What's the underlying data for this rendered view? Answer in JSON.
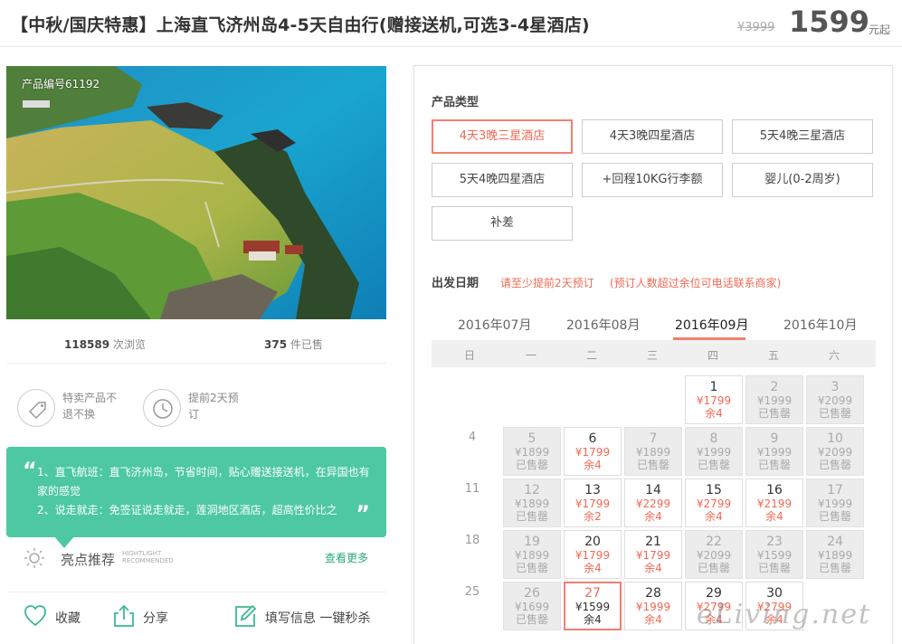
{
  "header": {
    "title": "【中秋/国庆特惠】上海直飞济州岛4-5天自由行(赠接送机,可选3-4星酒店)",
    "original_price": "¥3999",
    "price": "1599",
    "price_unit": "元起"
  },
  "gallery": {
    "product_code": "产品编号61192"
  },
  "stats": {
    "views_value": "118589",
    "views_label": "次浏览",
    "sold_value": "375",
    "sold_label": "件已售"
  },
  "promises": [
    {
      "icon": "tag-icon",
      "text": "特卖产品不退不换"
    },
    {
      "icon": "clock-icon",
      "text": "提前2天预订"
    }
  ],
  "highlights": {
    "lines": [
      "1、直飞航班：直飞济州岛，节省时间，贴心赠送接送机，在异国也有家的感觉",
      "2、说走就走：免签证说走就走，莲洞地区酒店，超高性价比之"
    ],
    "title": "亮点推荐",
    "title_en_1": "HIGHTLIGHT",
    "title_en_2": "RECOMMENDED",
    "more": "查看更多"
  },
  "actions": {
    "favorite": "收藏",
    "share": "分享",
    "fill_info": "填写信息 一键秒杀"
  },
  "product_type": {
    "label": "产品类型",
    "options": [
      "4天3晚三星酒店",
      "4天3晚四星酒店",
      "5天4晚三星酒店",
      "5天4晚四星酒店",
      "+回程10KG行李额",
      "婴儿(0-2周岁)",
      "补差"
    ],
    "selected_index": 0
  },
  "departure": {
    "label": "出发日期",
    "hint1": "请至少提前2天预订",
    "hint2": "(预订人数超过余位可电话联系商家)",
    "months": [
      "2016年07月",
      "2016年08月",
      "2016年09月",
      "2016年10月"
    ],
    "active_month_index": 2,
    "weekdays": [
      "日",
      "一",
      "二",
      "三",
      "四",
      "五",
      "六"
    ],
    "week_numbers": [
      "4",
      "11",
      "18",
      "25"
    ],
    "days": [
      {
        "day": "1",
        "price": "¥1799",
        "status": "余4",
        "state": "avail"
      },
      {
        "day": "2",
        "price": "¥1999",
        "status": "已售罄",
        "state": "sold"
      },
      {
        "day": "3",
        "price": "¥2099",
        "status": "已售罄",
        "state": "sold"
      },
      {
        "day": "5",
        "price": "¥1899",
        "status": "已售罄",
        "state": "sold"
      },
      {
        "day": "6",
        "price": "¥1799",
        "status": "余4",
        "state": "avail"
      },
      {
        "day": "7",
        "price": "¥1899",
        "status": "已售罄",
        "state": "sold"
      },
      {
        "day": "8",
        "price": "¥1999",
        "status": "已售罄",
        "state": "sold"
      },
      {
        "day": "9",
        "price": "¥1999",
        "status": "已售罄",
        "state": "sold"
      },
      {
        "day": "10",
        "price": "¥2099",
        "status": "已售罄",
        "state": "sold"
      },
      {
        "day": "12",
        "price": "¥1899",
        "status": "已售罄",
        "state": "sold"
      },
      {
        "day": "13",
        "price": "¥1799",
        "status": "余2",
        "state": "avail"
      },
      {
        "day": "14",
        "price": "¥2299",
        "status": "余4",
        "state": "avail"
      },
      {
        "day": "15",
        "price": "¥2799",
        "status": "余4",
        "state": "avail"
      },
      {
        "day": "16",
        "price": "¥2199",
        "status": "余4",
        "state": "avail"
      },
      {
        "day": "17",
        "price": "¥1999",
        "status": "已售罄",
        "state": "sold"
      },
      {
        "day": "19",
        "price": "¥1899",
        "status": "已售罄",
        "state": "sold"
      },
      {
        "day": "20",
        "price": "¥1799",
        "status": "余4",
        "state": "avail"
      },
      {
        "day": "21",
        "price": "¥1799",
        "status": "余4",
        "state": "avail"
      },
      {
        "day": "22",
        "price": "¥2099",
        "status": "已售罄",
        "state": "sold"
      },
      {
        "day": "23",
        "price": "¥1599",
        "status": "已售罄",
        "state": "sold"
      },
      {
        "day": "24",
        "price": "¥1899",
        "status": "已售罄",
        "state": "sold"
      },
      {
        "day": "26",
        "price": "¥1699",
        "status": "已售罄",
        "state": "sold"
      },
      {
        "day": "27",
        "price": "¥1599",
        "status": "余4",
        "state": "picked"
      },
      {
        "day": "28",
        "price": "¥1999",
        "status": "余4",
        "state": "avail"
      },
      {
        "day": "29",
        "price": "¥2799",
        "status": "余4",
        "state": "avail"
      },
      {
        "day": "30",
        "price": "¥2799",
        "status": "余4",
        "state": "avail"
      }
    ]
  },
  "watermark": "eLiving.net",
  "colors": {
    "accent": "#f06a55",
    "green": "#4dc8a1",
    "link_green": "#2aa77c"
  }
}
